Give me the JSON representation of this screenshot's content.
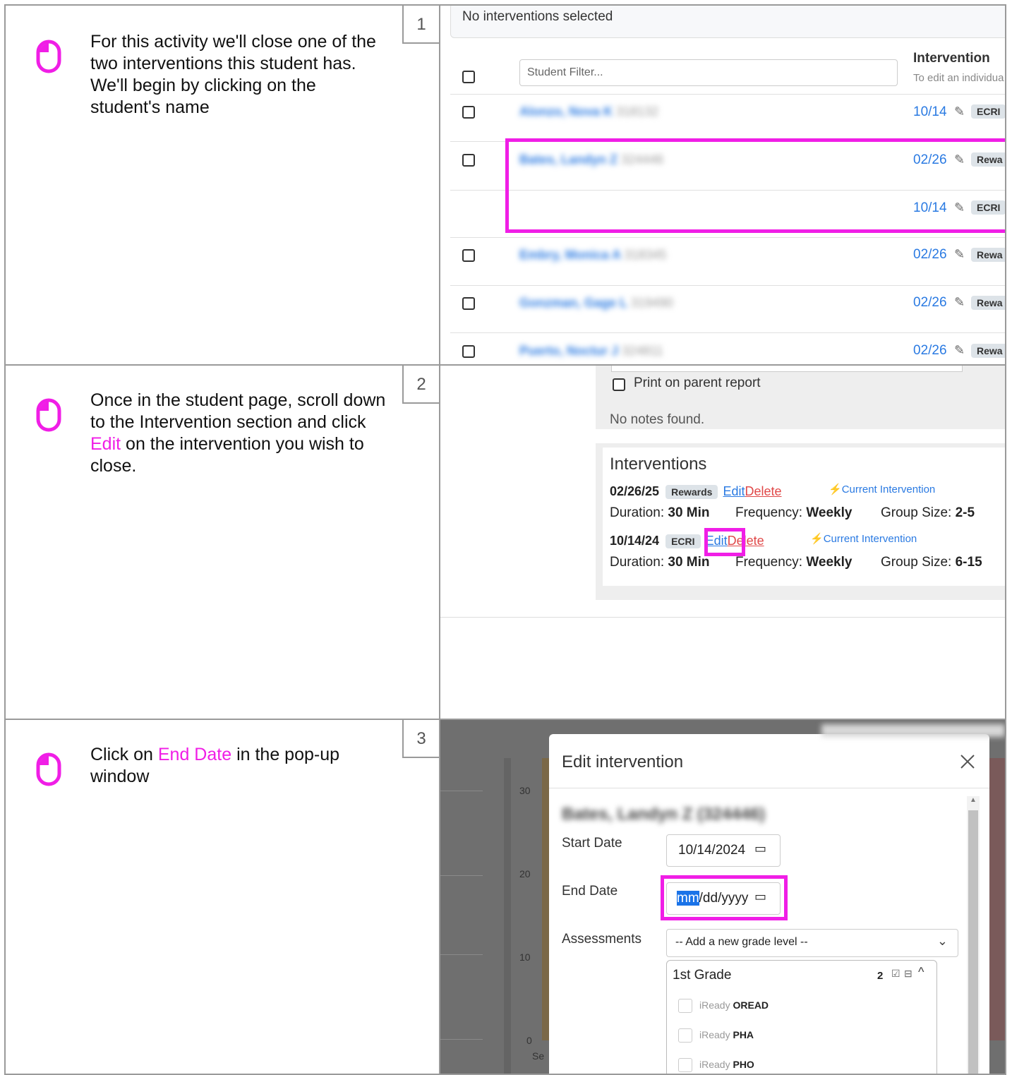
{
  "steps": [
    {
      "number": "1",
      "text": "For this activity we'll close one of the two interventions this student has.\nWe'll begin by clicking on the student's name"
    },
    {
      "number": "2",
      "text_before": "Once in the student page, scroll down to the Intervention section and click ",
      "highlight": "Edit",
      "text_after": " on the intervention you wish to close."
    },
    {
      "number": "3",
      "text_before": "Click on ",
      "highlight": "End Date",
      "text_after": " in the pop-up window"
    }
  ],
  "panel1": {
    "banner": "No interventions selected",
    "filter_placeholder": "Student Filter...",
    "column_header": "Intervention",
    "column_sub": "To edit an individua",
    "rows": [
      {
        "name": "Alonzo, Nova K",
        "id": "318132",
        "interventions": [
          {
            "date": "10/14",
            "tag": "ECRI"
          }
        ]
      },
      {
        "name": "Bates, Landyn Z",
        "id": "324446",
        "interventions": [
          {
            "date": "02/26",
            "tag": "Rewa"
          },
          {
            "date": "10/14",
            "tag": "ECRI"
          }
        ]
      },
      {
        "name": "Embry, Monica A",
        "id": "318345",
        "interventions": [
          {
            "date": "02/26",
            "tag": "Rewa"
          }
        ]
      },
      {
        "name": "Gonzman, Gage L",
        "id": "319490",
        "interventions": [
          {
            "date": "02/26",
            "tag": "Rewa"
          }
        ]
      },
      {
        "name": "Puerto, Noctur J",
        "id": "324811",
        "interventions": [
          {
            "date": "02/26",
            "tag": "Rewa"
          }
        ]
      }
    ]
  },
  "panel2": {
    "print_label": "Print on parent report",
    "no_notes": "No notes found.",
    "section_title": "Interventions",
    "edit_label": "Edit",
    "delete_label": "Delete",
    "current_label": "Current Intervention",
    "duration_label": "Duration:",
    "frequency_label": "Frequency:",
    "group_label": "Group Size:",
    "items": [
      {
        "date": "02/26/25",
        "tag": "Rewards",
        "duration": "30 Min",
        "frequency": "Weekly",
        "group": "2-5"
      },
      {
        "date": "10/14/24",
        "tag": "ECRI",
        "duration": "30 Min",
        "frequency": "Weekly",
        "group": "6-15"
      }
    ]
  },
  "panel3": {
    "modal_title": "Edit intervention",
    "student_name": "Bates, Landyn Z (324446)",
    "start_label": "Start Date",
    "start_value": "10/14/2024",
    "end_label": "End Date",
    "end_mm": "mm",
    "end_rest": "/dd/yyyy",
    "assess_label": "Assessments",
    "assess_select": "-- Add a new grade level --",
    "grade_title": "1st Grade",
    "grade_count": "2",
    "assess_items": [
      {
        "prefix": "iReady",
        "name": "OREAD"
      },
      {
        "prefix": "iReady",
        "name": "PHA"
      },
      {
        "prefix": "iReady",
        "name": "PHO"
      }
    ],
    "axis_ticks": [
      "30",
      "20",
      "10",
      "0"
    ],
    "axis_label": "Se"
  },
  "colors": {
    "highlight": "#f01ee6",
    "link": "#2a7ae2",
    "delete": "#e04848",
    "border": "#9a9a9a"
  }
}
